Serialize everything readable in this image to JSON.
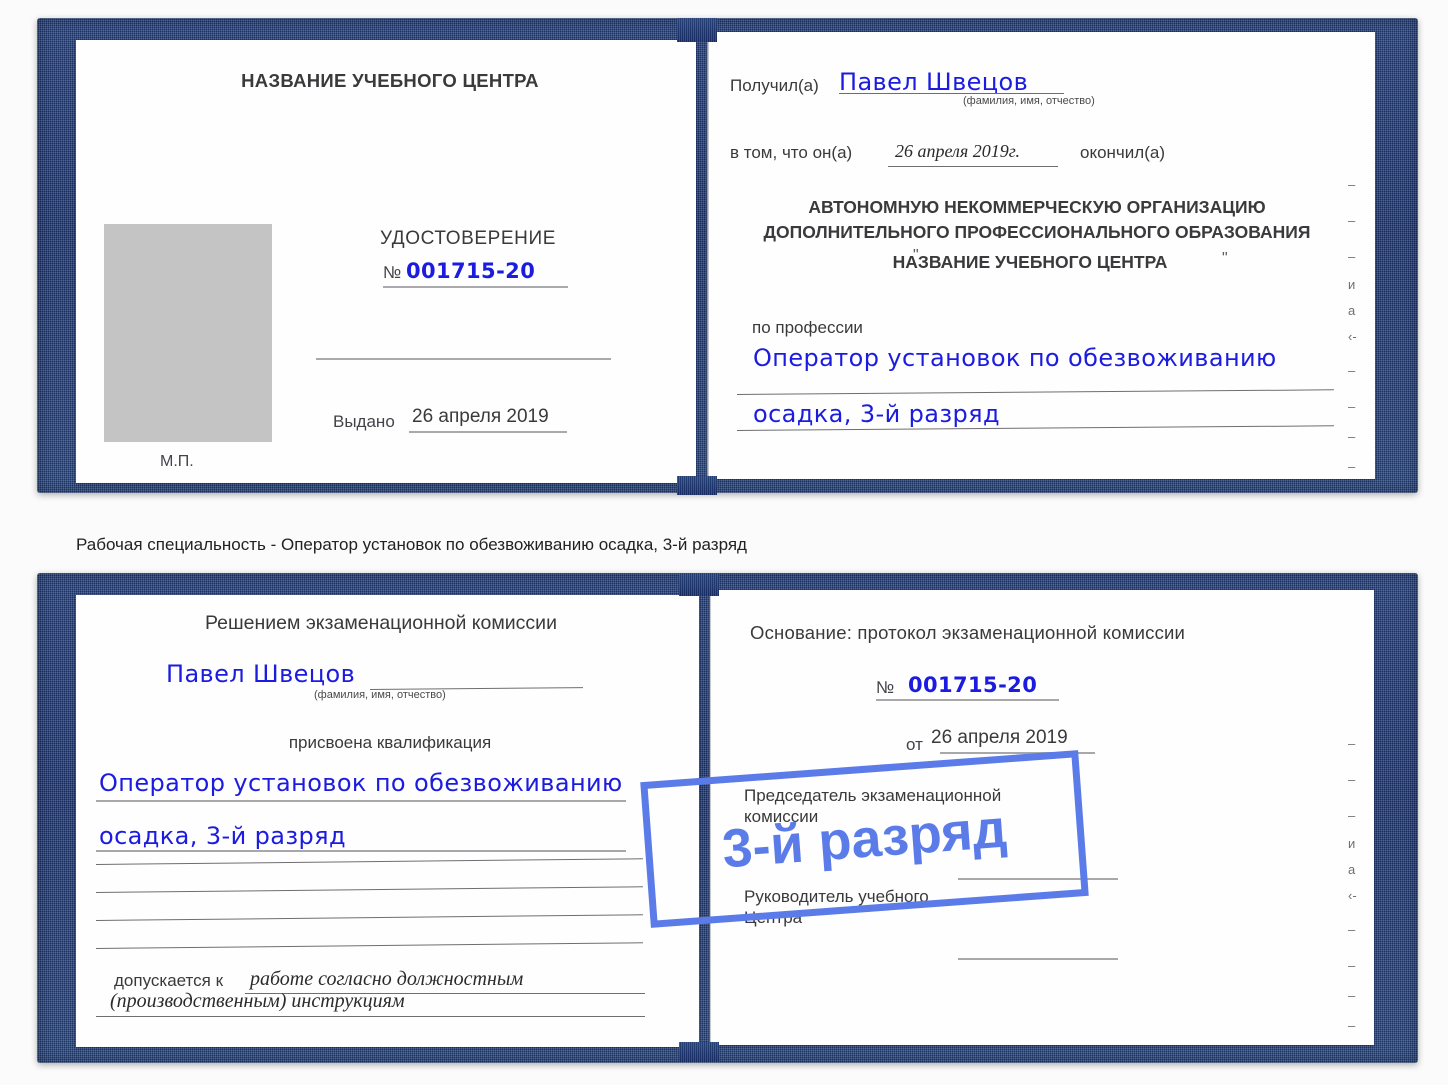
{
  "caption": {
    "text": "Рабочая специальность - Оператор установок по обезвоживанию осадка, 3-й разряд"
  },
  "watermark": {
    "label": "3-й разряд",
    "color": "#5b7ce8"
  },
  "colors": {
    "cover_blue": "#1d3572",
    "ink_blue": "#1c1ce0",
    "watermark_blue": "#5b7ce8",
    "photo_placeholder": "#c4c4c4",
    "rule_gray": "#9b9b9e"
  },
  "certificate_front": {
    "left_page": {
      "org_title": "НАЗВАНИЕ УЧЕБНОГО ЦЕНТРА",
      "doc_type": "УДОСТОВЕРЕНИЕ",
      "number_label": "№",
      "number_value": "001715-20",
      "issued_label": "Выдано",
      "issued_value": "26 апреля 2019",
      "seal_label": "М.П."
    },
    "right_page": {
      "received_label": "Получил(а)",
      "received_value": "Павел Швецов",
      "fio_hint": "(фамилия, имя, отчество)",
      "in_that_label": "в том, что он(а)",
      "completion_date": "26 апреля 2019г.",
      "finished_label": "окончил(а)",
      "org_line1": "АВТОНОМНУЮ НЕКОММЕРЧЕСКУЮ ОРГАНИЗАЦИЮ",
      "org_line2": "ДОПОЛНИТЕЛЬНОГО ПРОФЕССИОНАЛЬНОГО ОБРАЗОВАНИЯ",
      "org_quote_open": "\"",
      "org_line3": "НАЗВАНИЕ УЧЕБНОГО ЦЕНТРА",
      "org_quote_close": "\"",
      "profession_label": "по профессии",
      "profession_value_line1": "Оператор установок по обезвоживанию",
      "profession_value_line2": "осадка, 3-й разряд",
      "edge_glyphs": [
        "–",
        "–",
        "–",
        "и",
        "а",
        "‹-",
        "–",
        "–",
        "–",
        "–"
      ]
    }
  },
  "certificate_back": {
    "left_page": {
      "decision_title": "Решением экзаменационной комиссии",
      "name_value": "Павел Швецов",
      "fio_hint": "(фамилия, имя, отчество)",
      "qualification_label": "присвоена квалификация",
      "qualification_line1": "Оператор установок по обезвоживанию",
      "qualification_line2": "осадка, 3-й разряд",
      "admitted_label": "допускается к",
      "admitted_value_line1": "работе согласно должностным",
      "admitted_value_line2": "(производственным) инструкциям"
    },
    "right_page": {
      "basis_label": "Основание: протокол экзаменационной комиссии",
      "protocol_number_label": "№",
      "protocol_number_value": "001715-20",
      "protocol_date_label": "от",
      "protocol_date_value": "26 апреля 2019",
      "chairman_line1": "Председатель экзаменационной",
      "chairman_line2": "комиссии",
      "head_line1": "Руководитель учебного",
      "head_line2": "Центра",
      "edge_glyphs": [
        "–",
        "–",
        "–",
        "и",
        "а",
        "‹-",
        "–",
        "–",
        "–",
        "–"
      ]
    }
  }
}
